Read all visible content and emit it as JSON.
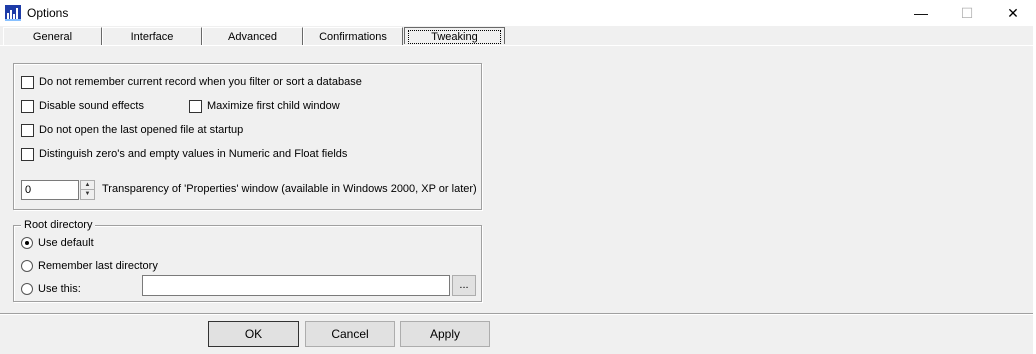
{
  "window": {
    "title": "Options",
    "controls": {
      "minimize": "—",
      "maximize": "☐",
      "close": "✕"
    }
  },
  "tabs": [
    {
      "label": "General",
      "active": false
    },
    {
      "label": "Interface",
      "active": false
    },
    {
      "label": "Advanced",
      "active": false
    },
    {
      "label": "Confirmations",
      "active": false
    },
    {
      "label": "Tweaking",
      "active": true
    }
  ],
  "options": {
    "no_remember_record": {
      "label": "Do not remember current record when you filter or sort a database",
      "checked": false
    },
    "disable_sound": {
      "label": "Disable sound effects",
      "checked": false
    },
    "maximize_child": {
      "label": "Maximize first child window",
      "checked": false
    },
    "no_open_last": {
      "label": "Do not open the last opened file at startup",
      "checked": false
    },
    "distinguish_zero": {
      "label": "Distinguish zero's and empty values in Numeric and Float fields",
      "checked": false
    },
    "transparency": {
      "value": "0",
      "label": "Transparency of 'Properties' window (available in Windows 2000, XP or later)"
    }
  },
  "root_directory": {
    "legend": "Root directory",
    "use_default": {
      "label": "Use default",
      "selected": true
    },
    "remember_last": {
      "label": "Remember last directory",
      "selected": false
    },
    "use_this": {
      "label": "Use this:",
      "selected": false
    },
    "path_value": "",
    "browse_label": "..."
  },
  "buttons": {
    "ok": "OK",
    "cancel": "Cancel",
    "apply": "Apply"
  },
  "colors": {
    "background": "#f0f0f0",
    "titlebar": "#ffffff",
    "icon_blue": "#1e3ca8"
  }
}
